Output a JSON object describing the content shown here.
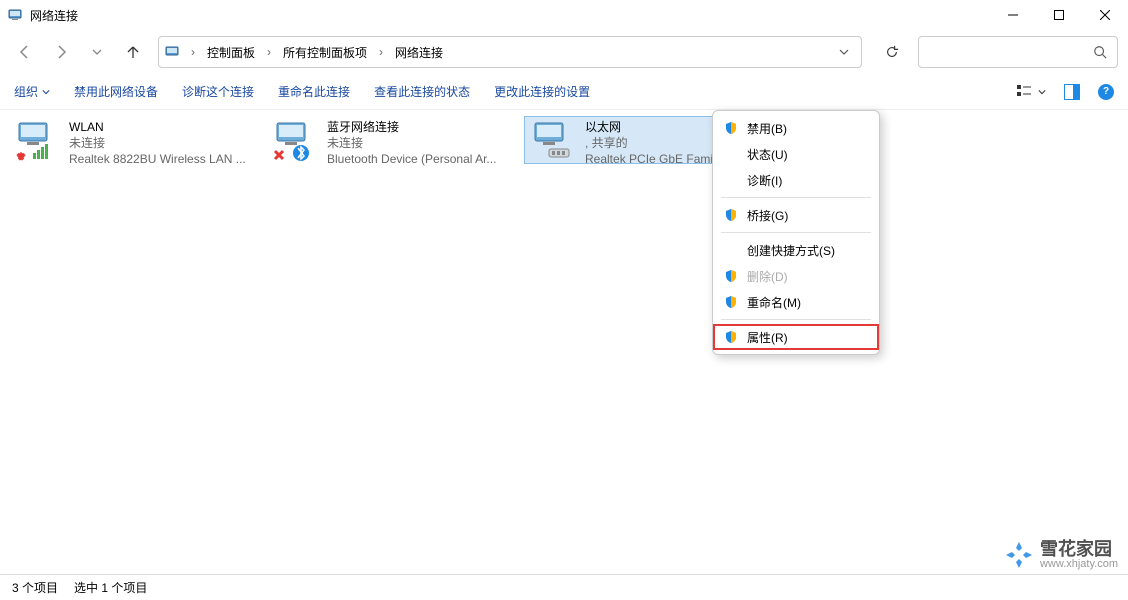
{
  "window": {
    "title": "网络连接"
  },
  "breadcrumbs": {
    "b0": "控制面板",
    "b1": "所有控制面板项",
    "b2": "网络连接"
  },
  "toolbar": {
    "organize": "组织",
    "disable": "禁用此网络设备",
    "diagnose": "诊断这个连接",
    "rename": "重命名此连接",
    "viewstatus": "查看此连接的状态",
    "changesettings": "更改此连接的设置"
  },
  "connections": {
    "wlan": {
      "name": "WLAN",
      "status": "未连接",
      "device": "Realtek 8822BU Wireless LAN ..."
    },
    "bt": {
      "name": "蓝牙网络连接",
      "status": "未连接",
      "device": "Bluetooth Device (Personal Ar..."
    },
    "eth": {
      "name": "以太网",
      "status": ", 共享的",
      "device": "Realtek PCIe GbE Famil..."
    }
  },
  "contextmenu": {
    "disable": "禁用(B)",
    "status": "状态(U)",
    "diagnose": "诊断(I)",
    "bridge": "桥接(G)",
    "shortcut": "创建快捷方式(S)",
    "delete": "删除(D)",
    "rename": "重命名(M)",
    "properties": "属性(R)"
  },
  "status": {
    "count": "3 个项目",
    "selected": "选中 1 个项目"
  },
  "watermark": {
    "name": "雪花家园",
    "url": "www.xhjaty.com"
  }
}
